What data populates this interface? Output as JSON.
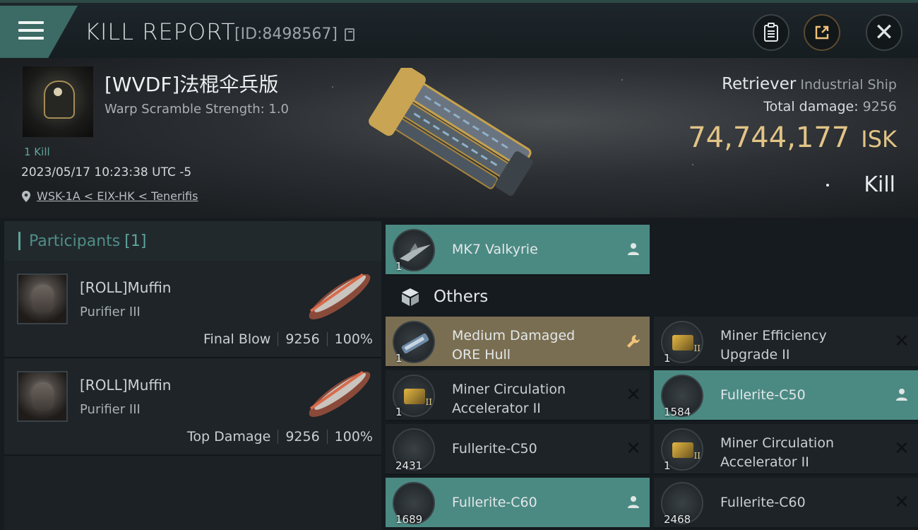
{
  "header": {
    "title": "KILL REPORT",
    "report_id": "[ID:8498567]"
  },
  "victim": {
    "pilot_name": "[WVDF]法棍伞兵版",
    "warp_scramble": "Warp Scramble Strength: 1.0",
    "kill_count": "1 Kill",
    "datetime": "2023/05/17 10:23:38 UTC -5",
    "location": "WSK-1A < EIX-HK < Tenerifis",
    "ship_name": "Retriever",
    "ship_class": "Industrial Ship",
    "total_damage_label": "Total damage:",
    "total_damage": "9256",
    "isk_value": "74,744,177",
    "isk_unit": "ISK",
    "result": "Kill"
  },
  "participants": {
    "label": "Participants",
    "count": "[1]",
    "rows": [
      {
        "name": "[ROLL]Muffin",
        "ship": "Purifier III",
        "role": "Final Blow",
        "damage": "9256",
        "percent": "100%"
      },
      {
        "name": "[ROLL]Muffin",
        "ship": "Purifier III",
        "role": "Top Damage",
        "damage": "9256",
        "percent": "100%"
      }
    ]
  },
  "items": {
    "drone": {
      "name": "MK7  Valkyrie",
      "qty": "1"
    },
    "others_label": "Others",
    "list": [
      {
        "name1": "Medium Damaged",
        "name2": "ORE Hull",
        "qty": "1"
      },
      {
        "name1": "Miner Efficiency",
        "name2": "Upgrade II",
        "qty": "1"
      },
      {
        "name1": "Miner Circulation",
        "name2": "Accelerator II",
        "qty": "1"
      },
      {
        "name1": "Fullerite-C50",
        "name2": "",
        "qty": "1584"
      },
      {
        "name1": "Fullerite-C50",
        "name2": "",
        "qty": "2431"
      },
      {
        "name1": "Miner Circulation",
        "name2": "Accelerator II",
        "qty": "1"
      },
      {
        "name1": "Fullerite-C60",
        "name2": "",
        "qty": "1689"
      },
      {
        "name1": "Fullerite-C60",
        "name2": "",
        "qty": "2468"
      }
    ]
  },
  "colors": {
    "accent_teal": "#4b8a83",
    "isk_gold": "#e2c486",
    "fitted_gold": "#7a6e52"
  }
}
